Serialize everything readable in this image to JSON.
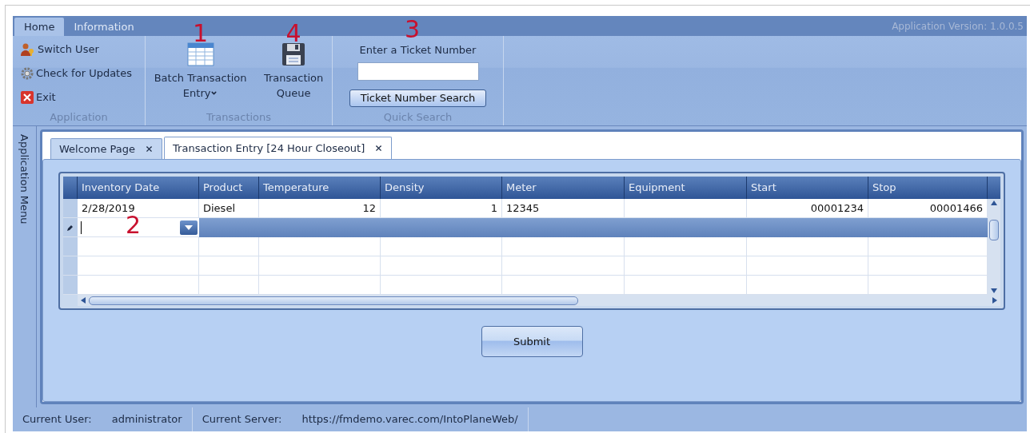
{
  "ribbon": {
    "tabs": [
      {
        "label": "Home",
        "selected": true
      },
      {
        "label": "Information",
        "selected": false
      }
    ],
    "version": "Application Version: 1.0.0.5",
    "application": {
      "title": "Application",
      "items": [
        {
          "label": "Switch User"
        },
        {
          "label": "Check for Updates"
        },
        {
          "label": "Exit"
        }
      ]
    },
    "transactions": {
      "title": "Transactions",
      "buttons": [
        {
          "lines": [
            "Batch Transaction",
            "Entry"
          ],
          "dropdown": true,
          "callout": "1"
        },
        {
          "lines": [
            "Transaction",
            "Queue"
          ],
          "dropdown": false,
          "callout": "4"
        }
      ]
    },
    "quick_search": {
      "title": "Quick Search",
      "label": "Enter a Ticket Number",
      "callout": "3",
      "button": "Ticket Number Search"
    }
  },
  "side_menu": {
    "label": "Application Menu"
  },
  "document_tabs": [
    {
      "label": "Welcome Page",
      "selected": false
    },
    {
      "label": "Transaction Entry [24 Hour Closeout]",
      "selected": true
    }
  ],
  "grid": {
    "columns": [
      {
        "label": "Inventory Date"
      },
      {
        "label": "Product"
      },
      {
        "label": "Temperature"
      },
      {
        "label": "Density"
      },
      {
        "label": "Meter"
      },
      {
        "label": "Equipment"
      },
      {
        "label": "Start"
      },
      {
        "label": "Stop"
      }
    ],
    "rows": [
      {
        "cells": [
          "2/28/2019",
          "Diesel",
          "12",
          "1",
          "12345",
          "",
          "00001234",
          "00001466"
        ],
        "editing": false
      },
      {
        "cells": [
          "",
          "",
          "",
          "",
          "",
          "",
          "",
          ""
        ],
        "editing": true,
        "callout": "2"
      }
    ]
  },
  "submit": "Submit",
  "status_bar": [
    {
      "label": "Current User:",
      "value": "administrator"
    },
    {
      "label": "Current Server:",
      "value": "https://fmdemo.varec.com/IntoPlaneWeb/"
    }
  ]
}
